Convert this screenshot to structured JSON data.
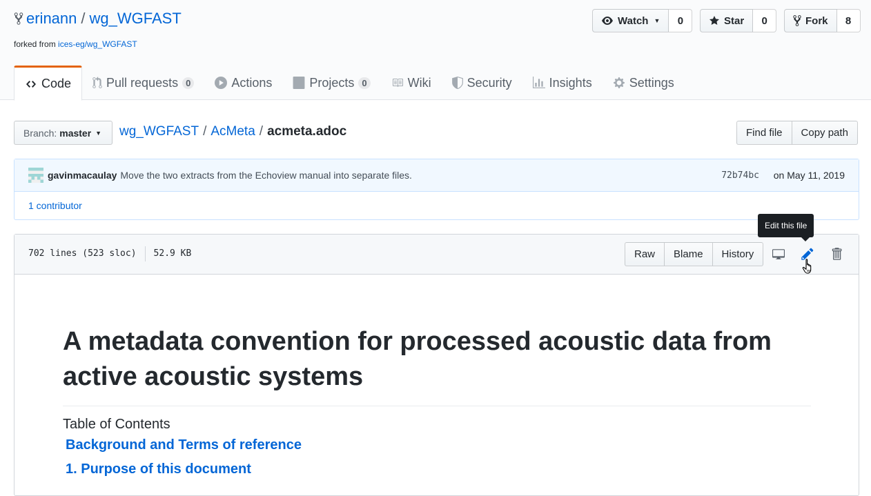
{
  "repo": {
    "owner": "erinann",
    "separator": "/",
    "name": "wg_WGFAST",
    "forked_prefix": "forked from",
    "forked_source": "ices-eg/wg_WGFAST"
  },
  "social": {
    "watch_label": "Watch",
    "watch_count": "0",
    "star_label": "Star",
    "star_count": "0",
    "fork_label": "Fork",
    "fork_count": "8"
  },
  "tabs": [
    {
      "label": "Code",
      "icon": "code-icon"
    },
    {
      "label": "Pull requests",
      "badge": "0",
      "icon": "pull-request-icon"
    },
    {
      "label": "Actions",
      "icon": "play-icon"
    },
    {
      "label": "Projects",
      "badge": "0",
      "icon": "project-icon"
    },
    {
      "label": "Wiki",
      "icon": "book-icon"
    },
    {
      "label": "Security",
      "icon": "shield-icon"
    },
    {
      "label": "Insights",
      "icon": "graph-icon"
    },
    {
      "label": "Settings",
      "icon": "gear-icon"
    }
  ],
  "filenav": {
    "branch_prefix": "Branch:",
    "branch_name": "master",
    "crumbs": [
      "wg_WGFAST",
      "AcMeta"
    ],
    "crumb_sep": "/",
    "file": "acmeta.adoc",
    "find_file": "Find file",
    "copy_path": "Copy path"
  },
  "commit": {
    "author": "gavinmacaulay",
    "message": "Move the two extracts from the Echoview manual into separate files.",
    "sha": "72b74bc",
    "date": "on May 11, 2019",
    "contributors": "1 contributor"
  },
  "file": {
    "lines": "702 lines (523 sloc)",
    "size": "52.9 KB",
    "raw": "Raw",
    "blame": "Blame",
    "history": "History",
    "tooltip": "Edit this file"
  },
  "doc": {
    "title": "A metadata convention for processed acoustic data from active acoustic systems",
    "toc_label": "Table of Contents",
    "toc": [
      "Background and Terms of reference",
      "1. Purpose of this document"
    ]
  },
  "colors": {
    "link": "#0366d6",
    "tab_accent": "#e36209",
    "commit_bg": "#f1f8ff"
  }
}
